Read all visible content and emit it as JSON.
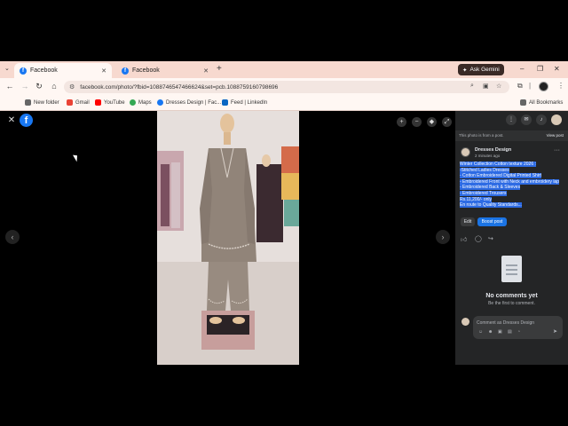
{
  "browser": {
    "tabs": [
      {
        "label": "Facebook",
        "icon": "facebook-icon"
      },
      {
        "label": "Facebook",
        "icon": "facebook-icon"
      }
    ],
    "ask_gemini": "Ask Gemini",
    "url": "facebook.com/photo/?fbid=1088746547466624&set=pcb.1088759160798696",
    "bookmarks": [
      {
        "label": "New folder",
        "icon": "folder-icon"
      },
      {
        "label": "Gmail",
        "icon": "gmail-icon"
      },
      {
        "label": "YouTube",
        "icon": "youtube-icon"
      },
      {
        "label": "Maps",
        "icon": "maps-icon"
      },
      {
        "label": "Dresses Design | Fac...",
        "icon": "facebook-icon"
      },
      {
        "label": "Feed | LinkedIn",
        "icon": "linkedin-icon"
      }
    ],
    "all_bookmarks": "All Bookmarks"
  },
  "panel": {
    "post_note": "This photo is from a post.",
    "view_post": "View post",
    "author": "Dresses Design",
    "time": "2 minutes ago",
    "caption_lines": [
      "Winter Collection Cotton texture 2026 :",
      "-Stitched Ladies Dresses",
      "- Cotton Embroidered Digital Printed Shirt",
      "- Embroidered Front with Neck and embroidery lap",
      "- Embroidered Back & Sleeves",
      "- Embroidered Trousers",
      "Rs.11,200/- only",
      "En route to Quality Standards..."
    ],
    "edit": "Edit",
    "boost": "Boost post",
    "no_comments": "No comments yet",
    "be_first": "Be the first to comment.",
    "comment_placeholder": "Comment as Dresses Design"
  },
  "colors": {
    "chrome_bg": "#f9e0d8",
    "panel_bg": "#242526",
    "accent": "#1b74e4",
    "highlight": "#2d6be4"
  }
}
